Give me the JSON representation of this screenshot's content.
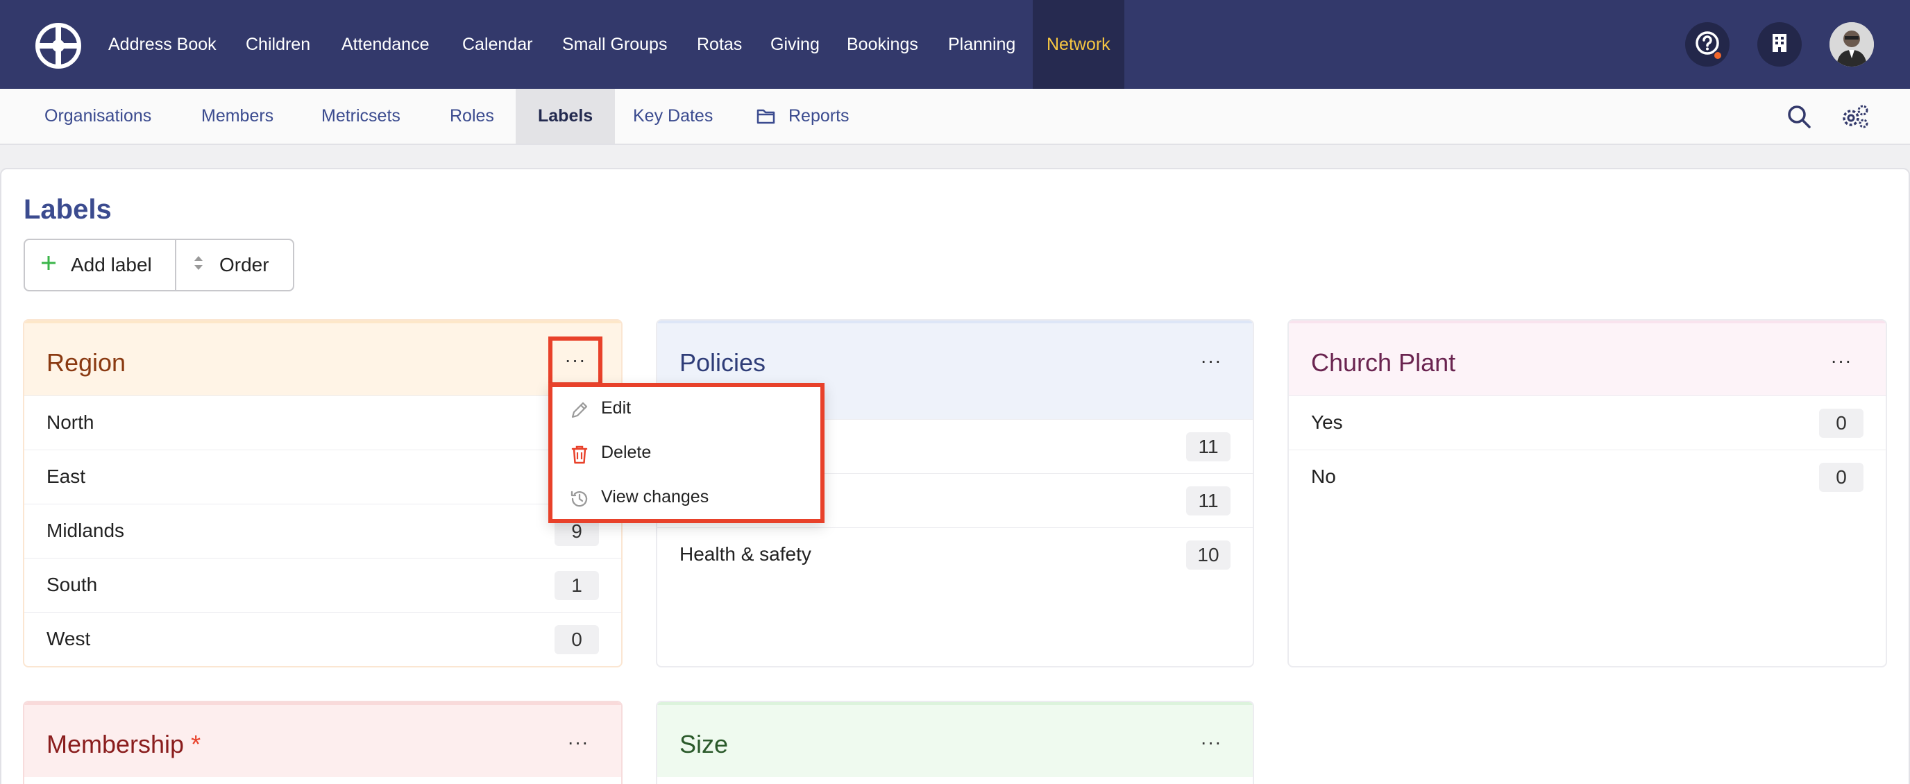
{
  "nav": {
    "items": [
      "Address Book",
      "Children",
      "Attendance",
      "Calendar",
      "Small Groups",
      "Rotas",
      "Giving",
      "Bookings",
      "Planning",
      "Network"
    ],
    "active": "Network",
    "icons": [
      "help-icon",
      "building-icon"
    ]
  },
  "subnav": {
    "items": [
      "Organisations",
      "Members",
      "Metricsets",
      "Roles",
      "Labels",
      "Key Dates",
      "Reports"
    ],
    "active": "Labels",
    "icons": [
      "search-icon",
      "settings-icon"
    ]
  },
  "page": {
    "title": "Labels",
    "add_label": "Add label",
    "order": "Order"
  },
  "cards": {
    "region": {
      "title": "Region",
      "rows": [
        {
          "label": "North",
          "count": ""
        },
        {
          "label": "East",
          "count": ""
        },
        {
          "label": "Midlands",
          "count": "9"
        },
        {
          "label": "South",
          "count": "1"
        },
        {
          "label": "West",
          "count": "0"
        }
      ]
    },
    "policies": {
      "title": "Policies",
      "rows": [
        {
          "label": "",
          "count": "11"
        },
        {
          "label": "",
          "count": "11"
        },
        {
          "label": "Health & safety",
          "count": "10"
        }
      ]
    },
    "church_plant": {
      "title": "Church Plant",
      "rows": [
        {
          "label": "Yes",
          "count": "0"
        },
        {
          "label": "No",
          "count": "0"
        }
      ]
    },
    "membership": {
      "title": "Membership",
      "required_mark": "*"
    },
    "size": {
      "title": "Size"
    }
  },
  "menu": {
    "edit": "Edit",
    "delete": "Delete",
    "view_changes": "View changes"
  },
  "colors": {
    "nav_bg": "#33396b",
    "accent_yellow": "#f5c542",
    "highlight_red": "#e8412a",
    "link_blue": "#3b4b8f"
  }
}
